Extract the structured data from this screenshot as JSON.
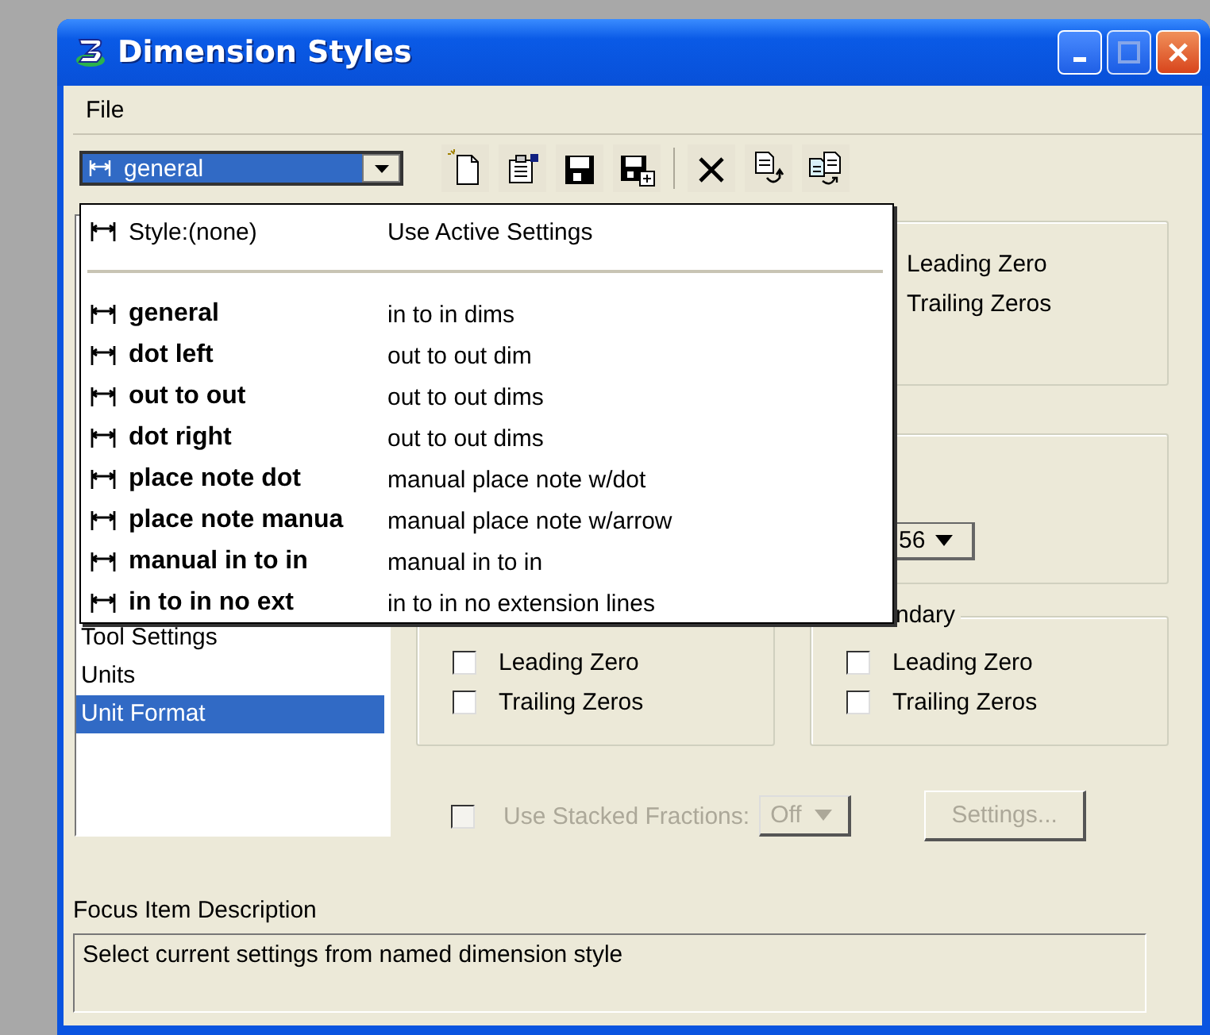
{
  "window": {
    "title": "Dimension Styles"
  },
  "menu": [
    {
      "label": "File"
    }
  ],
  "style_combo": {
    "value": "general",
    "focused": true
  },
  "style_menu": [
    {
      "kind": "none",
      "name": "Style:(none)",
      "description": "Use Active Settings"
    },
    {
      "kind": "separator"
    },
    {
      "kind": "style",
      "name": "general",
      "description": "in to in dims"
    },
    {
      "kind": "style",
      "name": "dot left",
      "description": "out to out dim"
    },
    {
      "kind": "style",
      "name": "out to out",
      "description": "out to out dims"
    },
    {
      "kind": "style",
      "name": "dot right",
      "description": "out to out dims"
    },
    {
      "kind": "style",
      "name": "place note dot",
      "description": "manual place note w/dot"
    },
    {
      "kind": "style",
      "name": "place note manua",
      "description": "manual place note w/arrow"
    },
    {
      "kind": "style",
      "name": "manual in to in",
      "description": "manual in to in"
    },
    {
      "kind": "style",
      "name": "in to in no ext",
      "description": "in to in no extension lines"
    }
  ],
  "categories": [
    {
      "label": "Tool Settings",
      "selected": false
    },
    {
      "label": "Units",
      "selected": false
    },
    {
      "label": "Unit Format",
      "selected": true
    }
  ],
  "top_group": {
    "options": [
      {
        "label": "Leading Zero"
      },
      {
        "label": "Trailing Zeros"
      }
    ]
  },
  "middle_group": {
    "combo_value": "56"
  },
  "primary_group": {
    "options": [
      {
        "label": "Leading Zero",
        "checked": false
      },
      {
        "label": "Trailing Zeros",
        "checked": false
      }
    ]
  },
  "secondary_group": {
    "legend": "ndary",
    "options": [
      {
        "label": "Leading Zero",
        "checked": false
      },
      {
        "label": "Trailing Zeros",
        "checked": false
      }
    ]
  },
  "stacked_fractions": {
    "label": "Use Stacked Fractions:",
    "checked": false,
    "disabled": true,
    "value": "Off"
  },
  "settings_button": {
    "label": "Settings...",
    "disabled": true
  },
  "focus_description": {
    "label": "Focus Item Description",
    "text": "Select current settings from named dimension style"
  }
}
